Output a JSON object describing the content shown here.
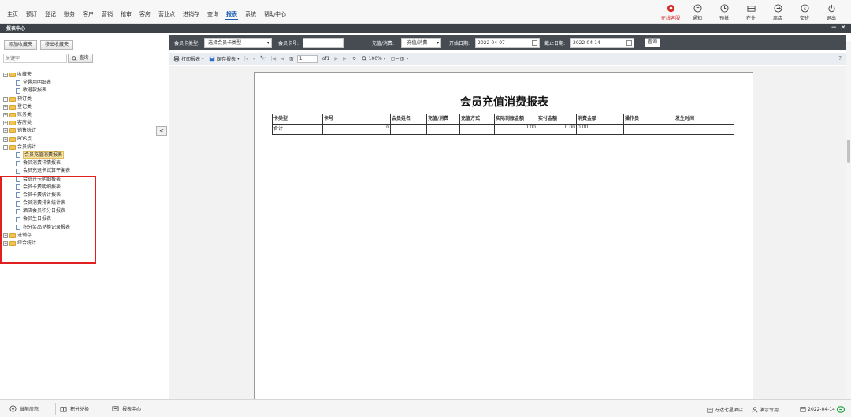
{
  "menu": [
    "主页",
    "预订",
    "登记",
    "账务",
    "客户",
    "营销",
    "稽审",
    "客房",
    "营业点",
    "进销存",
    "查询",
    "报表",
    "系统",
    "帮助中心"
  ],
  "active_menu": "报表",
  "tools": [
    {
      "label": "在线客服",
      "icon": "headset-icon"
    },
    {
      "label": "通知",
      "icon": "bell-icon"
    },
    {
      "label": "预抵",
      "icon": "clock-icon"
    },
    {
      "label": "在住",
      "icon": "bed-icon"
    },
    {
      "label": "离店",
      "icon": "exit-icon"
    },
    {
      "label": "交班",
      "icon": "handover-icon"
    },
    {
      "label": "退出",
      "icon": "power-icon"
    }
  ],
  "section": {
    "title": "报表中心",
    "minimize": "−",
    "close": "×"
  },
  "left": {
    "add_fav": "添加收藏夹",
    "remove_fav": "移出收藏夹",
    "keyword_placeholder": "关键字",
    "search_label": "查询",
    "collapse": "<"
  },
  "tree": [
    {
      "label": "收藏夹",
      "type": "folder",
      "toggle": "−"
    },
    {
      "label": "全趣用明细表",
      "type": "doc"
    },
    {
      "label": "收退款报表",
      "type": "doc"
    },
    {
      "label": "预订类",
      "type": "folder",
      "toggle": "+"
    },
    {
      "label": "登记类",
      "type": "folder",
      "toggle": "+"
    },
    {
      "label": "账务类",
      "type": "folder",
      "toggle": "+"
    },
    {
      "label": "客房类",
      "type": "folder",
      "toggle": "+"
    },
    {
      "label": "销售统计",
      "type": "folder",
      "toggle": "+"
    },
    {
      "label": "POS点",
      "type": "folder",
      "toggle": "+"
    },
    {
      "label": "会员统计",
      "type": "folder",
      "toggle": "−"
    },
    {
      "label": "会员充值消费报表",
      "type": "doc",
      "selected": true
    },
    {
      "label": "会员消费详情报表",
      "type": "doc"
    },
    {
      "label": "会员充退卡试算平衡表",
      "type": "doc"
    },
    {
      "label": "会员开卡明细报表",
      "type": "doc"
    },
    {
      "label": "会员卡费明细报表",
      "type": "doc"
    },
    {
      "label": "会员卡费统计报表",
      "type": "doc"
    },
    {
      "label": "会员消费排名统计表",
      "type": "doc"
    },
    {
      "label": "酒店会员积分日报表",
      "type": "doc"
    },
    {
      "label": "会员生日报表",
      "type": "doc"
    },
    {
      "label": "积分奖品兑换记录报表",
      "type": "doc"
    },
    {
      "label": "进销存",
      "type": "folder",
      "toggle": "+"
    },
    {
      "label": "综合统计",
      "type": "folder",
      "toggle": "+"
    }
  ],
  "filter": {
    "card_type_label": "会员卡类型:",
    "card_type_value": "-选择会员卡类型-",
    "card_no_label": "会员卡号:",
    "card_no_value": "",
    "charge_label": "充值/消费:",
    "charge_value": "--充值/消费--",
    "start_label": "开始日期:",
    "start_value": "2022-04-07",
    "end_label": "截止日期:",
    "end_value": "2022-04-14",
    "query": "查询"
  },
  "rtoolbar": {
    "print": "打印报表",
    "save": "保存报表",
    "page_label": "页",
    "page_value": "1",
    "of": "of1",
    "zoom": "100%",
    "onepage": "一页",
    "help": "?"
  },
  "report": {
    "title": "会员充值消费报表",
    "headers": [
      "卡类型",
      "卡号",
      "会员姓名",
      "充值/消费",
      "充值方式",
      "实际到账金额",
      "实付金额",
      "消费金额",
      "操作员",
      "发生时间"
    ],
    "total_row": [
      "合计：",
      "0",
      "",
      "",
      "",
      "0.00",
      "0.00",
      "0.00",
      "",
      ""
    ]
  },
  "status": {
    "items": [
      {
        "label": "当前房态",
        "icon": "room-status-icon"
      },
      {
        "label": "积分兑换",
        "icon": "gift-icon"
      },
      {
        "label": "报表中心",
        "icon": "report-icon"
      }
    ],
    "hotel": "万达七星酒店",
    "user": "演示专用",
    "date": "2022-04-14"
  },
  "colors": {
    "accent": "#1a5fb4",
    "dark_bar": "#474c52",
    "section_bar": "#3d4248",
    "highlight": "#e02020",
    "live": "#d42a2a"
  }
}
